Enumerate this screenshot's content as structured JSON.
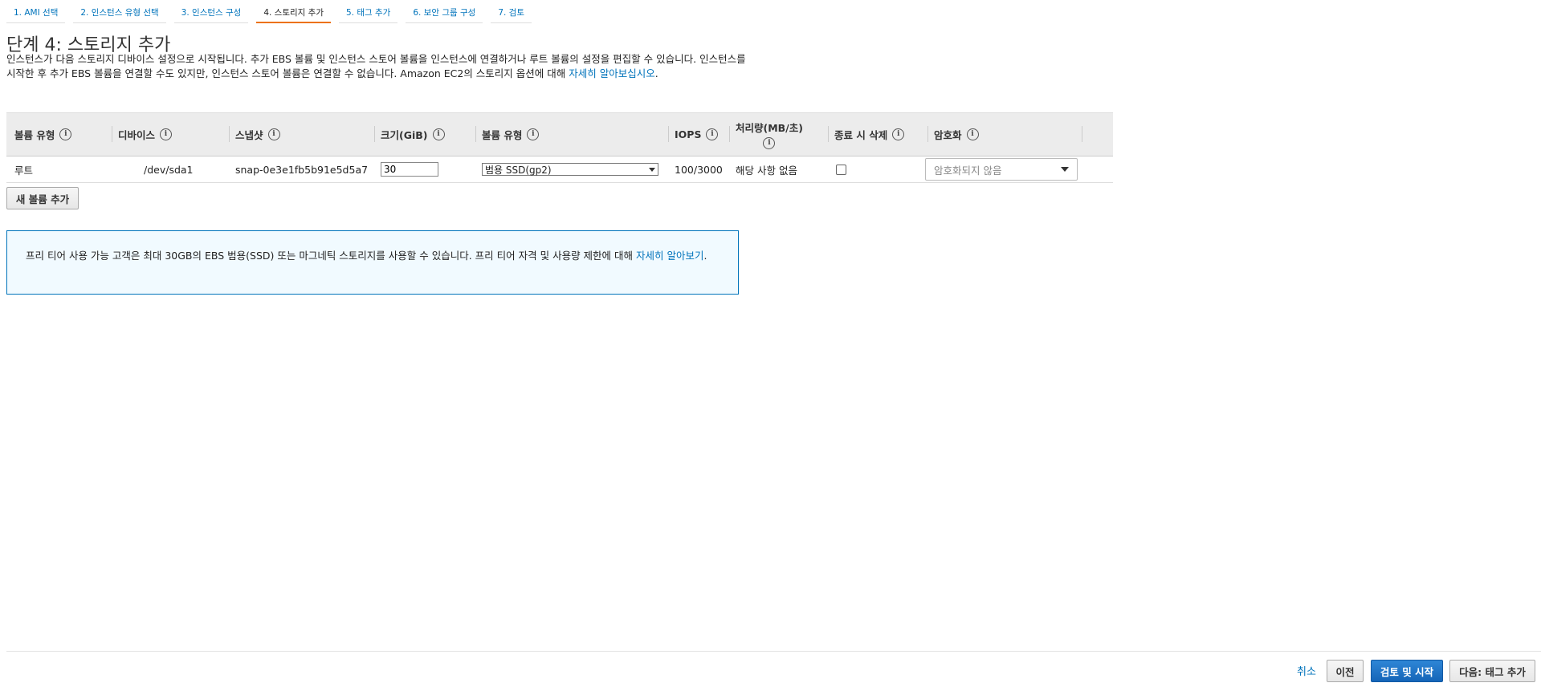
{
  "wizard_tabs": [
    {
      "label": "1. AMI 선택",
      "active": false
    },
    {
      "label": "2. 인스턴스 유형 선택",
      "active": false
    },
    {
      "label": "3. 인스턴스 구성",
      "active": false
    },
    {
      "label": "4. 스토리지 추가",
      "active": true
    },
    {
      "label": "5. 태그 추가",
      "active": false
    },
    {
      "label": "6. 보안 그룹 구성",
      "active": false
    },
    {
      "label": "7. 검토",
      "active": false
    }
  ],
  "page": {
    "title": "단계 4: 스토리지 추가",
    "description": "인스턴스가 다음 스토리지 디바이스 설정으로 시작됩니다. 추가 EBS 볼륨 및 인스턴스 스토어 볼륨을 인스턴스에 연결하거나 루트 볼륨의 설정을 편집할 수 있습니다. 인스턴스를 시작한 후 추가 EBS 볼륨을 연결할 수도 있지만, 인스턴스 스토어 볼륨은 연결할 수 없습니다. Amazon EC2의 스토리지 옵션에 대해 ",
    "description_link": "자세히 알아보십시오",
    "description_end": "."
  },
  "table": {
    "headers": {
      "volume_kind": "볼륨 유형",
      "device": "디바이스",
      "snapshot": "스냅샷",
      "size": "크기(GiB)",
      "volume_type": "볼륨 유형",
      "iops": "IOPS",
      "throughput": "처리량(MB/초)",
      "delete_on_termination": "종료 시 삭제",
      "encryption": "암호화"
    },
    "info_glyph": "i",
    "rows": [
      {
        "volume_kind": "루트",
        "device": "/dev/sda1",
        "snapshot": "snap-0e3e1fb5b91e5d5a7",
        "size": "30",
        "volume_type": "범용 SSD(gp2)",
        "iops": "100/3000",
        "throughput": "해당 사항 없음",
        "delete_on_termination": false,
        "encryption": "암호화되지 않음"
      }
    ]
  },
  "add_volume_button": "새 볼륨 추가",
  "notice": {
    "text": "프리 티어 사용 가능 고객은 최대 30GB의 EBS 범용(SSD) 또는 마그네틱 스토리지를 사용할 수 있습니다. 프리 티어 자격 및 사용량 제한에 대해 ",
    "link": "자세히 알아보기",
    "end": "."
  },
  "footer": {
    "cancel": "취소",
    "previous": "이전",
    "review_launch": "검토 및 시작",
    "next": "다음: 태그 추가"
  },
  "colors": {
    "link": "#0073bb",
    "active_tab_underline": "#ec7211",
    "primary_button": "#1a6fc4",
    "notice_border": "#0073bb",
    "notice_bg": "#f1faff"
  }
}
